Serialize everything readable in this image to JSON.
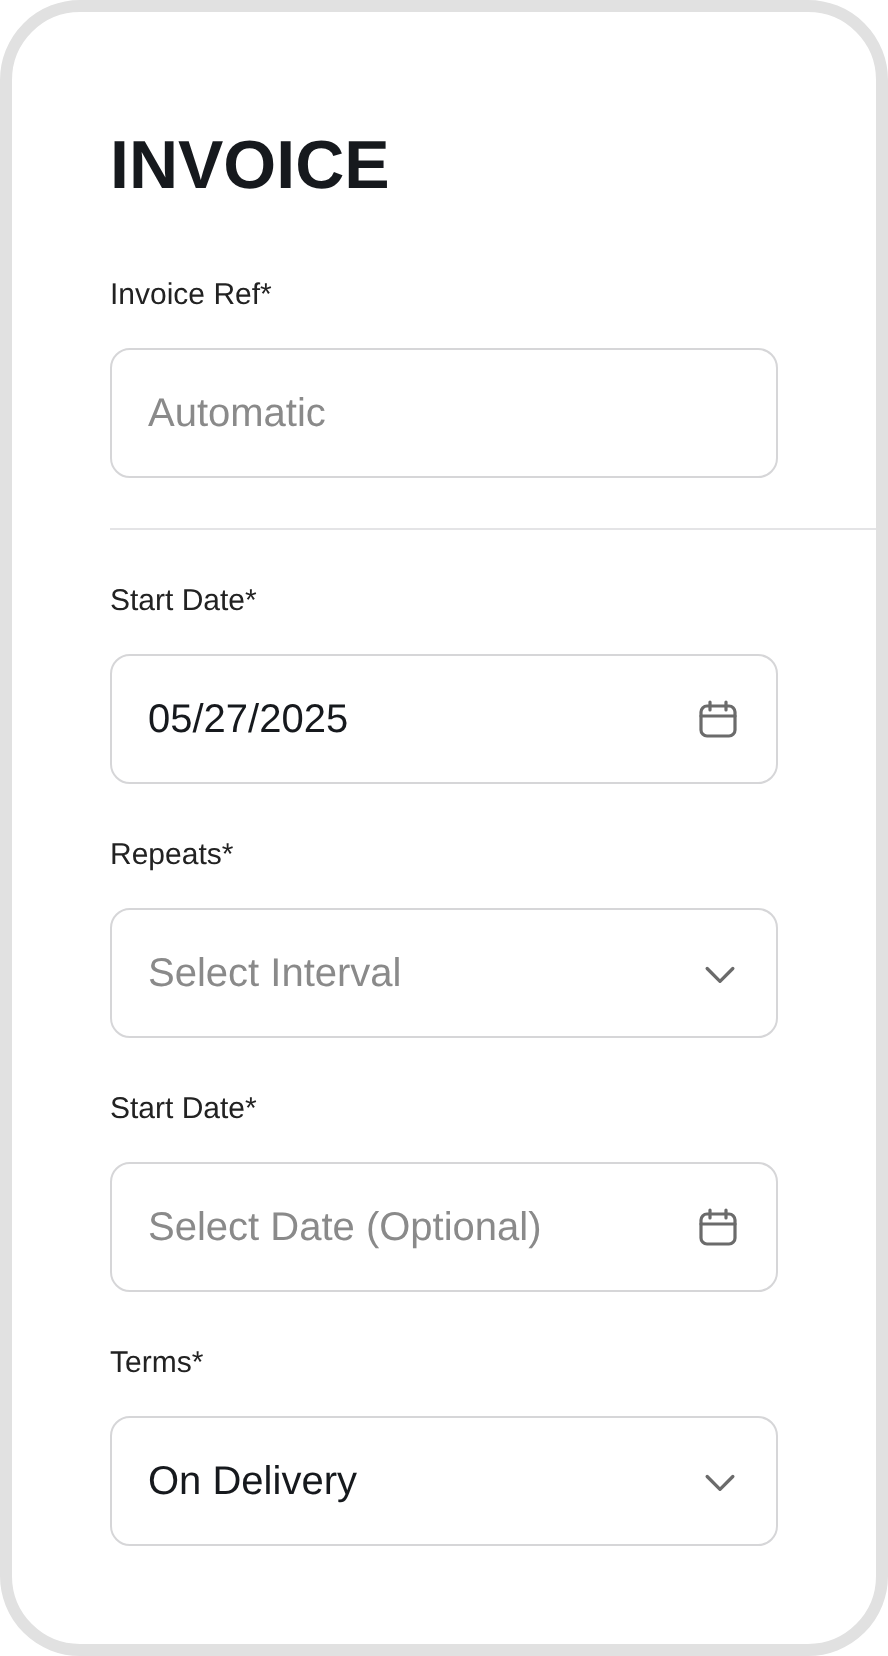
{
  "title": "INVOICE",
  "sections": [
    {
      "fields": [
        {
          "kind": "text",
          "label": "Invoice Ref*",
          "placeholder": "Automatic"
        }
      ]
    },
    {
      "fields": [
        {
          "kind": "date",
          "label": "Start Date*",
          "value": "05/27/2025"
        },
        {
          "kind": "select",
          "label": "Repeats*",
          "placeholder": "Select Interval"
        },
        {
          "kind": "date",
          "label": "Start Date*",
          "placeholder": "Select Date (Optional)"
        },
        {
          "kind": "select",
          "label": "Terms*",
          "value": "On Delivery"
        }
      ]
    }
  ]
}
